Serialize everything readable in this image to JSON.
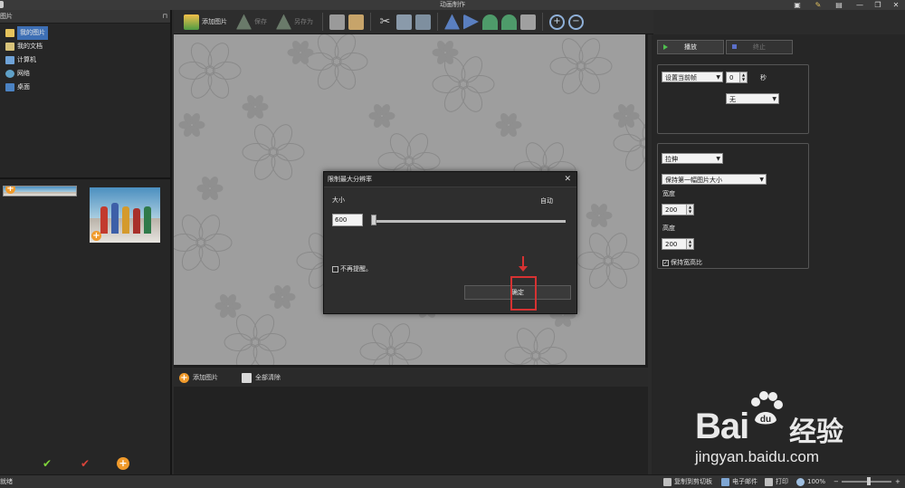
{
  "window": {
    "title": "动画制作",
    "controls": [
      "▣",
      "✎",
      "▤",
      "—",
      "❐",
      "✕"
    ]
  },
  "left_panel": {
    "header": "图片",
    "pin_icon": "pin-icon",
    "tree": [
      {
        "label": "我的图片",
        "icon": "folder-icon",
        "selected": true
      },
      {
        "label": "我的文档",
        "icon": "documents-icon",
        "selected": false
      },
      {
        "label": "计算机",
        "icon": "computer-icon",
        "selected": false
      },
      {
        "label": "网络",
        "icon": "network-icon",
        "selected": false
      },
      {
        "label": "桌面",
        "icon": "desktop-icon",
        "selected": false
      }
    ],
    "bottom_icons": [
      "check-green-icon",
      "check-red-icon",
      "add-orange-icon"
    ]
  },
  "toolbar": {
    "add_image": "添加图片",
    "save": "保存",
    "save_as": "另存为"
  },
  "canvas_footer": {
    "add_image": "添加图片",
    "clear_all": "全部清除"
  },
  "right_panel": {
    "play": "播放",
    "stop": "终止",
    "frame_select": "设置当前帧",
    "seconds_value": "0",
    "seconds_unit": "秒",
    "effect_select": "无",
    "stretch_select": "拉伸",
    "keep_size_select": "保持第一幅图片大小",
    "width_label": "宽度",
    "width_value": "200",
    "height_label": "高度",
    "height_value": "200",
    "keep_ratio": "保持宽高比"
  },
  "dialog": {
    "title": "限制最大分辨率",
    "size_label": "大小",
    "auto_label": "自动",
    "size_value": "600",
    "dont_remind": "不再提醒。",
    "ok": "确定"
  },
  "statusbar": {
    "status": "就绪",
    "copy_clipboard": "复制到剪切板",
    "email": "电子邮件",
    "print": "打印",
    "zoom": "100%"
  },
  "watermark": {
    "brand": "Bai",
    "brand2": "du",
    "cn": "经验",
    "url": "jingyan.baidu.com"
  },
  "colors": {
    "accent": "#3d6fb5",
    "highlight": "#d63232",
    "orange": "#f09a2b"
  }
}
